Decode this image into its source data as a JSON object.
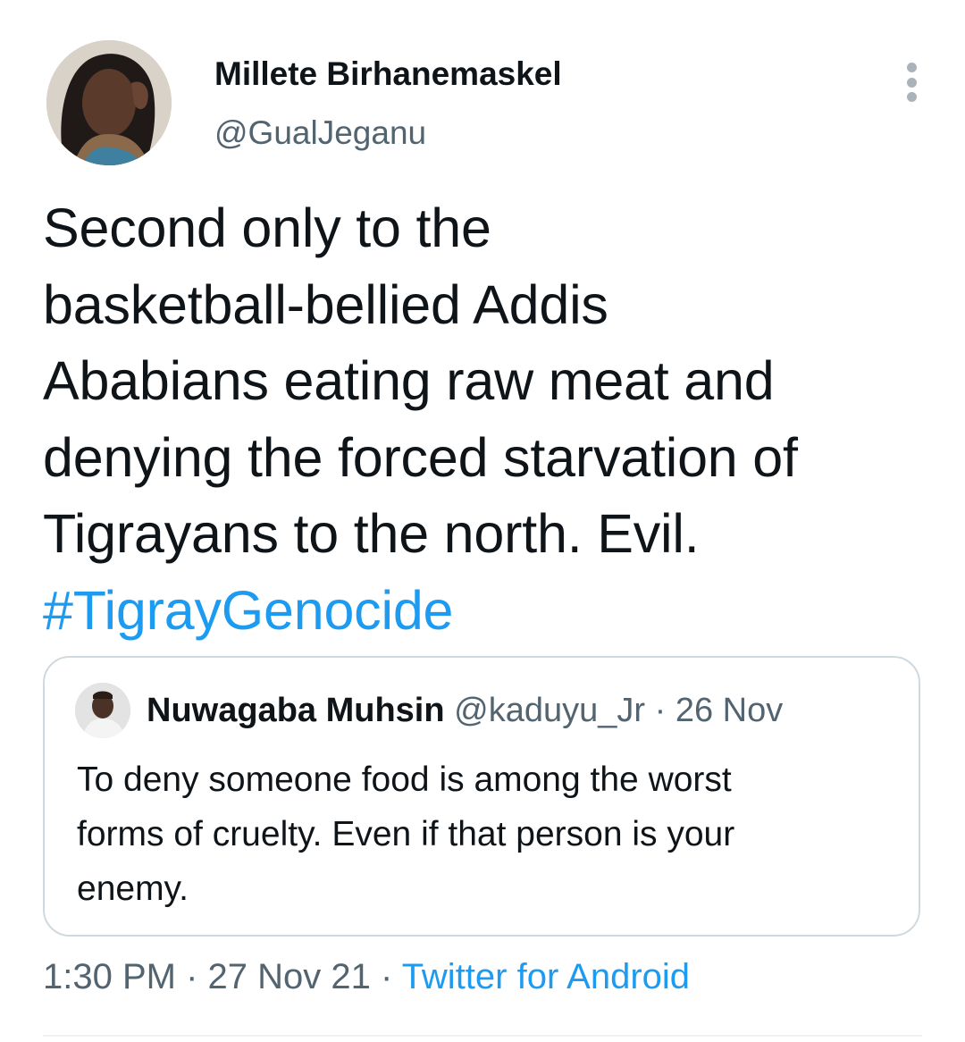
{
  "author": {
    "display_name": "Millete Birhanemaskel",
    "handle": "@GualJeganu"
  },
  "tweet": {
    "lines": [
      "Second only to the",
      "basketball-bellied Addis",
      "Ababians eating raw meat and",
      "denying the forced starvation of",
      "Tigrayans to the north. Evil."
    ],
    "hashtag": "#TigrayGenocide"
  },
  "quoted_tweet": {
    "display_name": "Nuwagaba Muhsin",
    "handle": "@kaduyu_Jr",
    "separator": " · ",
    "date": "26 Nov",
    "lines": [
      "To deny someone food is among the worst",
      "forms of cruelty. Even if that person is your",
      "enemy."
    ]
  },
  "footer": {
    "time": "1:30 PM",
    "separator": " · ",
    "date": "27 Nov 21",
    "source": "Twitter for Android"
  },
  "colors": {
    "accent": "#1d9bf0",
    "text": "#0f1419",
    "secondary": "#536471",
    "border": "#cfd9de"
  },
  "icons": {
    "more": "more-vertical-icon"
  }
}
